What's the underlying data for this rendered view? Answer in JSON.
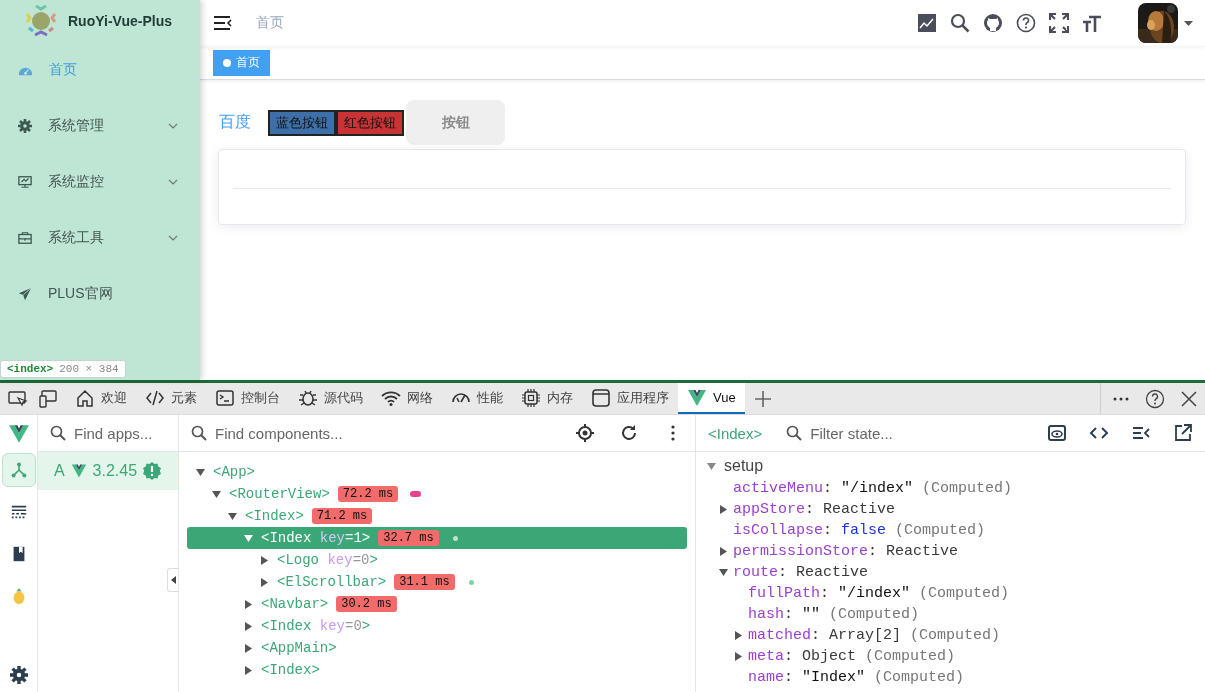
{
  "sidebar": {
    "title": "RuoYi-Vue-Plus",
    "items": [
      {
        "label": "首页",
        "kind": "dashboard",
        "selected": true
      },
      {
        "label": "系统管理",
        "kind": "settings",
        "selected": false,
        "expanded": false
      },
      {
        "label": "系统监控",
        "kind": "monitor",
        "selected": false,
        "expanded": false
      },
      {
        "label": "系统工具",
        "kind": "toolbox",
        "selected": false,
        "expanded": false
      },
      {
        "label": "PLUS官网",
        "kind": "send",
        "selected": false
      }
    ]
  },
  "inspect_tooltip": {
    "tag": "<index>",
    "size": "200 × 384"
  },
  "navbar": {
    "breadcrumb": "首页"
  },
  "tags": [
    {
      "label": "首页",
      "selected": true
    }
  ],
  "content": {
    "link": "百度",
    "buttons": [
      {
        "label": "蓝色按钮",
        "color": "#3d6fa8",
        "disabled": false
      },
      {
        "label": "红色按钮",
        "color": "#c83434",
        "disabled": false
      },
      {
        "label": "按钮",
        "color": "#efefef",
        "disabled": true
      }
    ]
  },
  "devtools": {
    "tabs": [
      {
        "label": "欢迎",
        "kind": "home",
        "selected": false
      },
      {
        "label": "元素",
        "kind": "code",
        "selected": false
      },
      {
        "label": "控制台",
        "kind": "console",
        "selected": false
      },
      {
        "label": "源代码",
        "kind": "bug",
        "selected": false
      },
      {
        "label": "网络",
        "kind": "wifi",
        "selected": false
      },
      {
        "label": "性能",
        "kind": "gauge",
        "selected": false
      },
      {
        "label": "内存",
        "kind": "chip",
        "selected": false
      },
      {
        "label": "应用程序",
        "kind": "window",
        "selected": false
      },
      {
        "label": "Vue",
        "kind": "vue",
        "selected": true
      }
    ],
    "nav": [
      {
        "kind": "components",
        "selected": true
      },
      {
        "kind": "timeline",
        "selected": false
      },
      {
        "kind": "docs",
        "selected": false
      },
      {
        "kind": "plugin",
        "selected": false
      }
    ],
    "apps": {
      "placeholder": "Find apps...",
      "items": [
        {
          "name": "A",
          "version": "3.2.45",
          "selected": true
        }
      ]
    },
    "components": {
      "placeholder": "Find components...",
      "tree": [
        {
          "label": "<App>",
          "expanded": true,
          "selected": false,
          "children": [
            {
              "label": "<RouterView>",
              "time": "72.2 ms",
              "marker": {
                "kind": "pill",
                "color": "#e8418c"
              },
              "expanded": true,
              "selected": false,
              "children": [
                {
                  "label": "<Index>",
                  "time": "71.2 ms",
                  "expanded": true,
                  "selected": false,
                  "children": [
                    {
                      "label": "<Index",
                      "attr_name": "key",
                      "attr_value": "=1",
                      "close": ">",
                      "time": "32.7 ms",
                      "marker": {
                        "kind": "dot",
                        "color": "#b9e3cf"
                      },
                      "expanded": true,
                      "selected": true,
                      "children": [
                        {
                          "label": "<Logo",
                          "attr_name": "key",
                          "attr_value": "=0",
                          "close": ">",
                          "expanded": false,
                          "selected": false
                        },
                        {
                          "label": "<ElScrollbar>",
                          "time": "31.1 ms",
                          "marker": {
                            "kind": "dot",
                            "color": "#7fd3ab"
                          },
                          "expanded": false,
                          "selected": false
                        }
                      ]
                    },
                    {
                      "label": "<Navbar>",
                      "time": "30.2 ms",
                      "expanded": false,
                      "selected": false
                    },
                    {
                      "label": "<Index",
                      "attr_name": "key",
                      "attr_value": "=0",
                      "close": ">",
                      "expanded": false,
                      "selected": false
                    },
                    {
                      "label": "<AppMain>",
                      "expanded": false,
                      "selected": false
                    },
                    {
                      "label": "<Index>",
                      "expanded": false,
                      "selected": false
                    }
                  ]
                }
              ]
            }
          ]
        }
      ]
    },
    "state": {
      "component": "<Index>",
      "placeholder": "Filter state...",
      "sections": [
        {
          "title": "setup",
          "expanded": true,
          "rows": [
            {
              "key": "activeMenu",
              "sep": ":",
              "value": "\"/index\"",
              "kind": "string",
              "note": "(Computed)"
            },
            {
              "key": "appStore",
              "sep": ":",
              "value": "Reactive",
              "kind": "object",
              "expanded": false
            },
            {
              "key": "isCollapse",
              "sep": ":",
              "value": "false",
              "kind": "boolean",
              "note": "(Computed)"
            },
            {
              "key": "permissionStore",
              "sep": ":",
              "value": "Reactive",
              "kind": "object",
              "expanded": false
            },
            {
              "key": "route",
              "sep": ":",
              "value": "Reactive",
              "kind": "object",
              "expanded": true,
              "children": [
                {
                  "key": "fullPath",
                  "sep": ":",
                  "value": "\"/index\"",
                  "kind": "string",
                  "note": "(Computed)"
                },
                {
                  "key": "hash",
                  "sep": ":",
                  "value": "\"\"",
                  "kind": "string",
                  "note": "(Computed)"
                },
                {
                  "key": "matched",
                  "sep": ":",
                  "value": "Array[2]",
                  "kind": "object",
                  "note": "(Computed)",
                  "expanded": false
                },
                {
                  "key": "meta",
                  "sep": ":",
                  "value": "Object",
                  "kind": "object",
                  "note": "(Computed)",
                  "expanded": false
                },
                {
                  "key": "name",
                  "sep": ":",
                  "value": "\"Index\"",
                  "kind": "string",
                  "note": "(Computed)"
                }
              ]
            }
          ]
        }
      ]
    }
  }
}
